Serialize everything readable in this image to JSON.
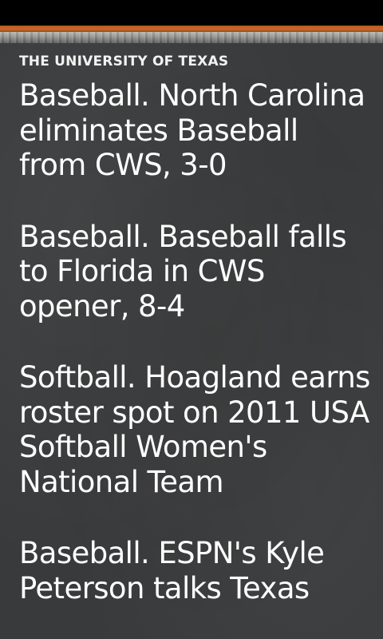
{
  "header": {
    "title": "THE UNIVERSITY OF TEXAS"
  },
  "feed": {
    "items": [
      {
        "headline": "Baseball. North Carolina eliminates Baseball from CWS, 3-0"
      },
      {
        "headline": "Baseball. Baseball falls to Florida in CWS opener, 8-4"
      },
      {
        "headline": "Softball. Hoagland earns roster spot on 2011 USA Softball Women's National Team"
      },
      {
        "headline": "Baseball. ESPN's Kyle Peterson talks Texas"
      }
    ]
  },
  "colors": {
    "accent": "#c05f22",
    "board": "#393a3b",
    "text": "#ffffff"
  }
}
